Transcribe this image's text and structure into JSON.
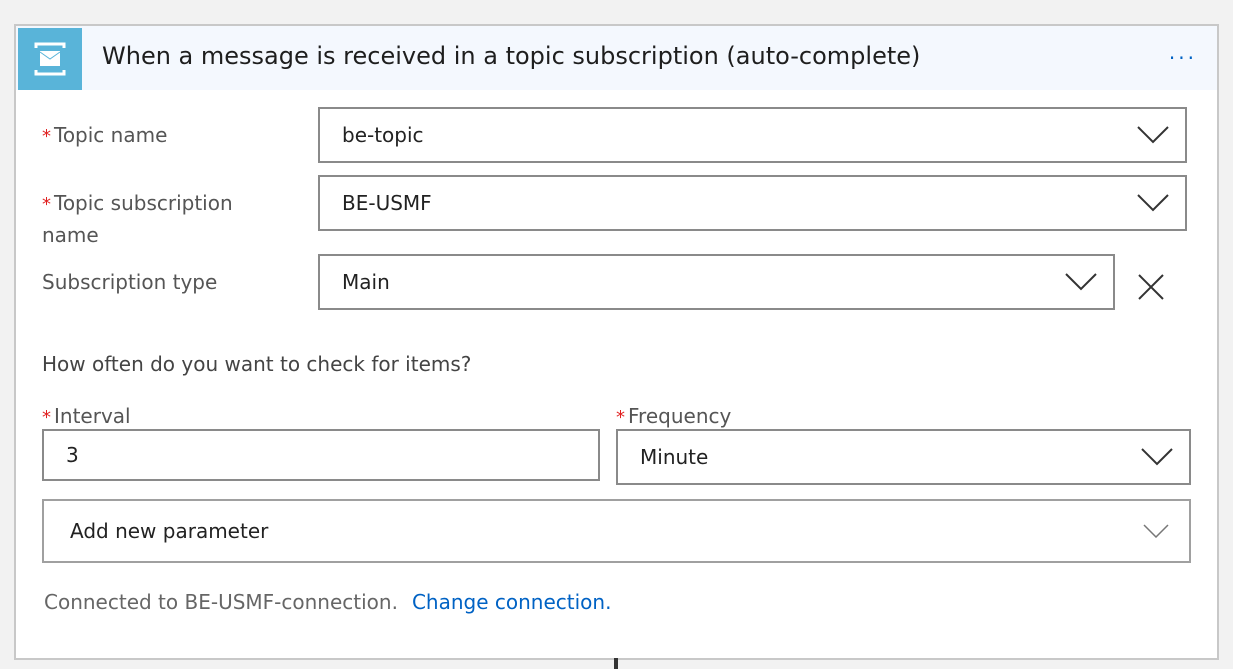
{
  "header": {
    "title": "When a message is received in a topic subscription (auto-complete)",
    "more_label": "···",
    "icon": "service-bus-envelope-icon",
    "icon_color": "#59b4d9"
  },
  "fields": {
    "topic_name": {
      "label": "Topic name",
      "required": "*",
      "value": "be-topic"
    },
    "topic_subscription": {
      "label": "Topic subscription name",
      "required": "*",
      "value": "BE-USMF"
    },
    "subscription_type": {
      "label": "Subscription type",
      "value": "Main"
    }
  },
  "recurrence": {
    "question": "How often do you want to check for items?",
    "interval": {
      "label": "Interval",
      "required": "*",
      "value": "3"
    },
    "frequency": {
      "label": "Frequency",
      "required": "*",
      "value": "Minute"
    }
  },
  "add_parameter": {
    "label": "Add new parameter"
  },
  "connection": {
    "text": "Connected to BE-USMF-connection.",
    "link": "Change connection."
  },
  "colors": {
    "accent": "#0062c4",
    "required": "#e02020"
  }
}
